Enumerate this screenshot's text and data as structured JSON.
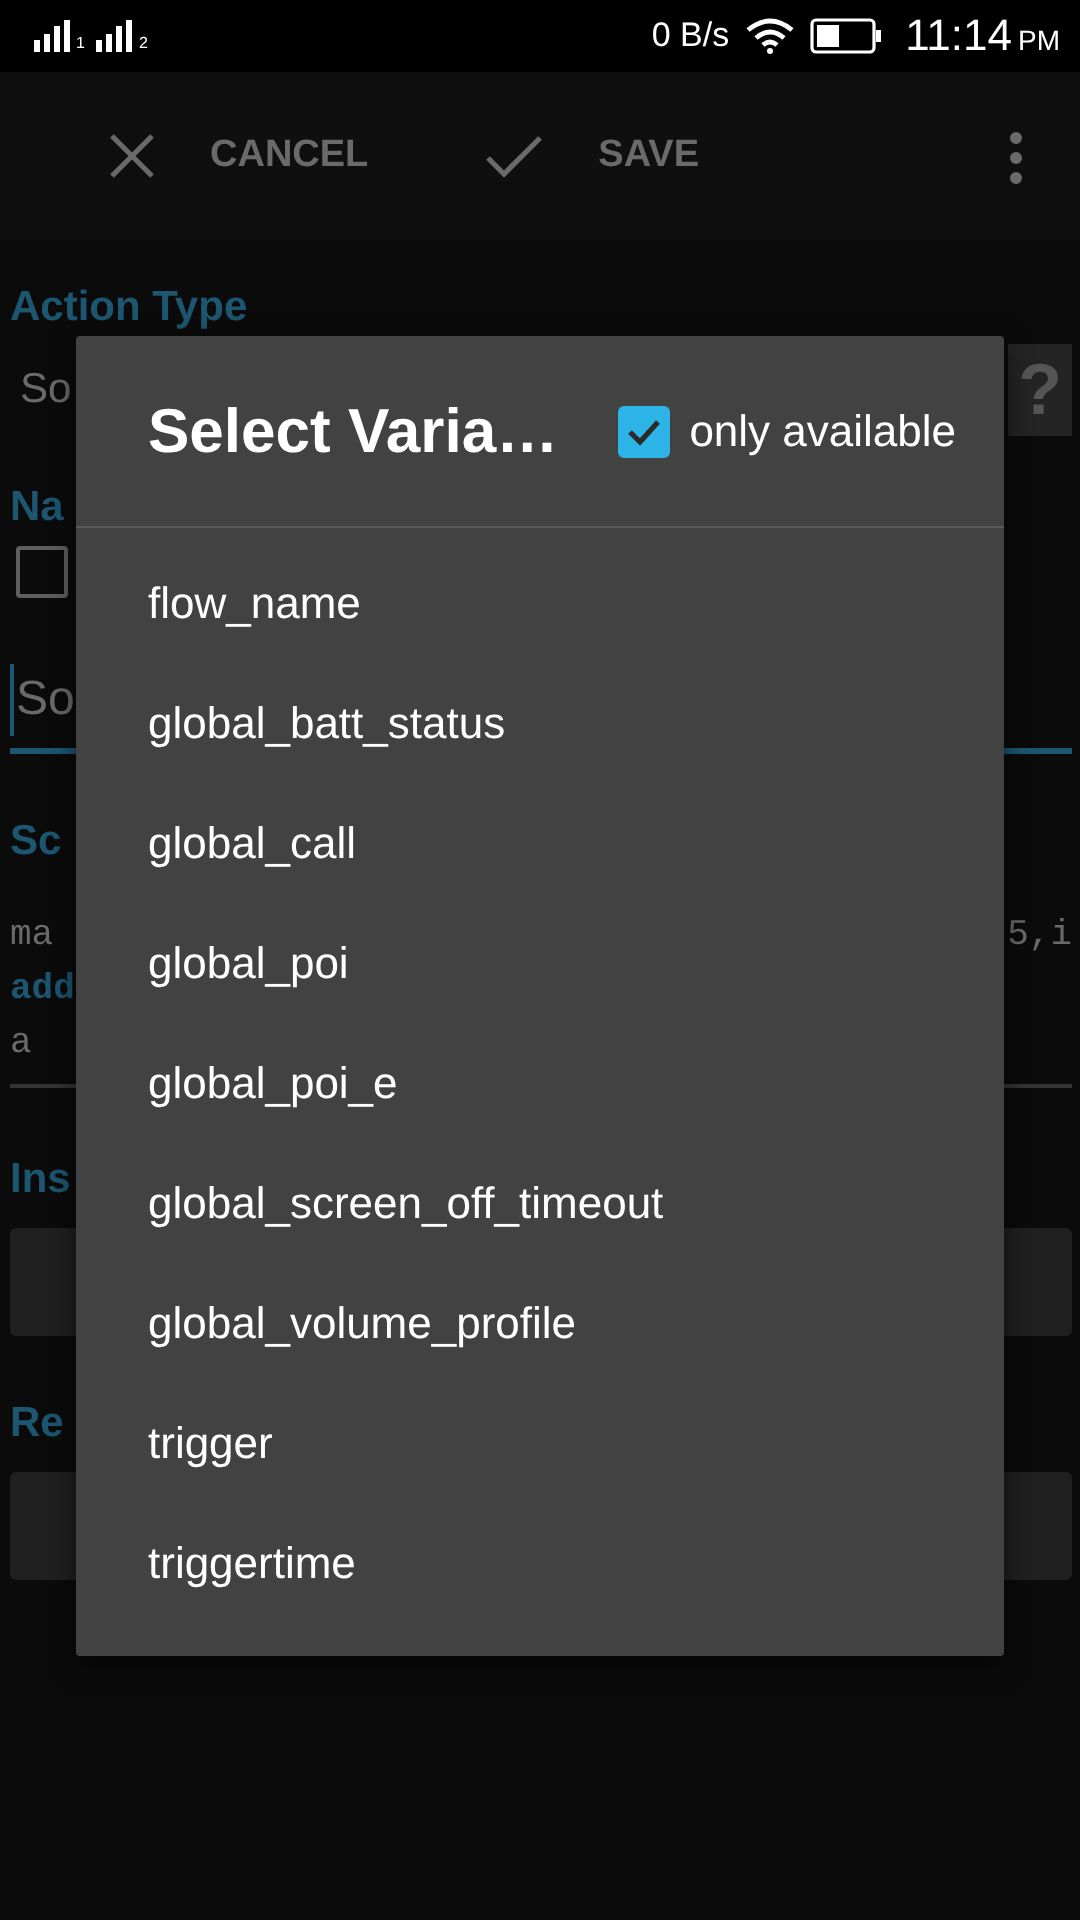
{
  "status_bar": {
    "sim_labels": [
      "1",
      "2"
    ],
    "net_speed": "0 B/s",
    "time": "11:14",
    "meridiem": "PM"
  },
  "toolbar": {
    "cancel": "CANCEL",
    "save": "SAVE"
  },
  "form": {
    "action_type_label": "Action Type",
    "action_type_value": "So",
    "help_button": "?",
    "name_label": "Na",
    "name_checkbox": {
      "checked": false
    },
    "name_field": "So",
    "script_label": "Sc",
    "code_lines": [
      {
        "kind": "plain",
        "left": "ma",
        "right": "5,i"
      },
      {
        "kind": "keyword",
        "left": "add"
      },
      {
        "kind": "plain",
        "left": "a"
      }
    ],
    "input_label": "Ins",
    "result_label": "Re"
  },
  "dialog": {
    "title": "Select Varia…",
    "only_available": {
      "label": "only available",
      "checked": true
    },
    "items": [
      {
        "label": "flow_name",
        "selected": false
      },
      {
        "label": "global_batt_status",
        "selected": false
      },
      {
        "label": "global_call",
        "selected": false
      },
      {
        "label": "global_poi",
        "selected": false
      },
      {
        "label": "global_poi_e",
        "selected": false
      },
      {
        "label": "global_screen_off_timeout",
        "selected": false
      },
      {
        "label": "global_volume_profile",
        "selected": false
      },
      {
        "label": "trigger",
        "selected": false
      },
      {
        "label": "triggertime",
        "selected": false
      }
    ]
  }
}
